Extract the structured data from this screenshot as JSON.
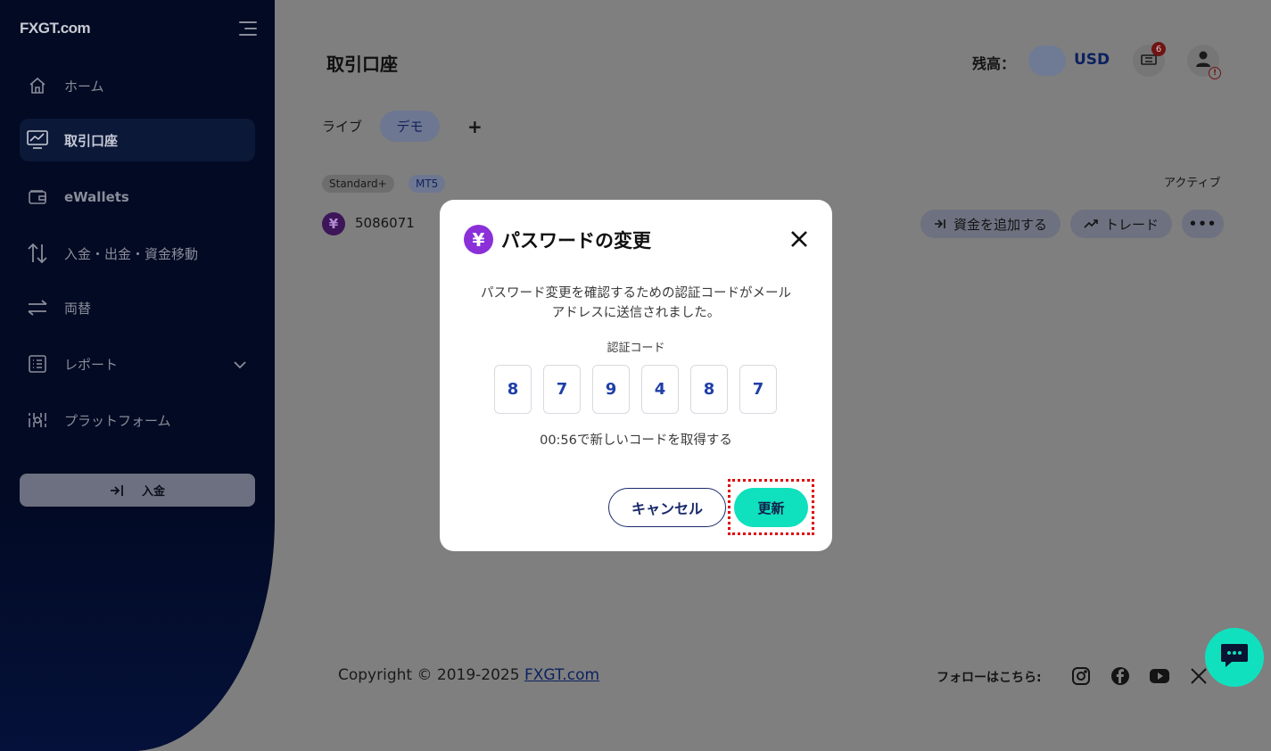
{
  "sidebar": {
    "logo": {
      "prefix": "FX",
      "brand": "GT",
      "suffix": ".com"
    },
    "items": [
      {
        "label": "ホーム",
        "icon": "home-icon"
      },
      {
        "label": "取引口座",
        "icon": "chart-icon",
        "active": true
      },
      {
        "label": "eWallets",
        "icon": "wallet-icon"
      },
      {
        "label": "入金・出金・資金移動",
        "icon": "transfer-icon"
      },
      {
        "label": "両替",
        "icon": "exchange-icon"
      },
      {
        "label": "レポート",
        "icon": "report-icon"
      },
      {
        "label": "プラットフォーム",
        "icon": "platform-icon"
      }
    ],
    "deposit_label": "入金"
  },
  "header": {
    "title": "取引口座",
    "balance_label": "残高：",
    "currency": "USD",
    "notification_count": "6"
  },
  "tabs": [
    {
      "label": "ライブ"
    },
    {
      "label": "デモ",
      "active": true
    },
    {
      "label": "+"
    }
  ],
  "account": {
    "type": "Standard+",
    "platform": "MT5",
    "status": "アクティブ",
    "currency_symbol": "¥",
    "number": "5086071",
    "actions": {
      "add_funds": "資金を追加する",
      "trade": "トレード",
      "more": "•••"
    }
  },
  "footer": {
    "copyright": "Copyright © 2019-2025 ",
    "link": "FXGT.com",
    "follow_label": "フォローはこちら:",
    "social": [
      "instagram-icon",
      "facebook-icon",
      "youtube-icon",
      "x-icon"
    ]
  },
  "modal": {
    "icon_symbol": "¥",
    "title": "パスワードの変更",
    "message_line1": "パスワード変更を確認するための認証コードがメール",
    "message_line2": "アドレスに送信されました。",
    "code_label": "認証コード",
    "code_digits": [
      "8",
      "7",
      "9",
      "4",
      "8",
      "7"
    ],
    "resend_text": "00:56で新しいコードを取得する",
    "cancel_label": "キャンセル",
    "update_label": "更新"
  },
  "colors": {
    "sidebar_bg": "#020a24",
    "accent_teal": "#0fe0bd",
    "brand_purple": "#8b2fd8",
    "navy": "#1a2a6a",
    "highlight_red": "#e00000"
  }
}
